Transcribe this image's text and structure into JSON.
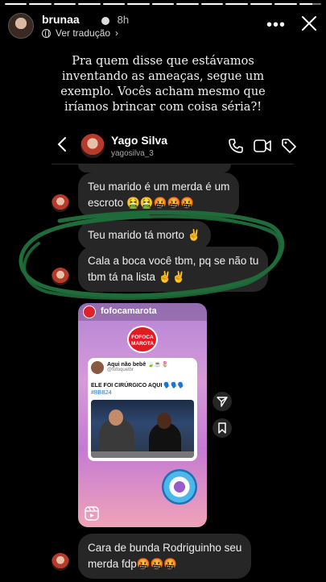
{
  "story": {
    "segments": [
      1,
      1,
      1,
      1,
      1,
      1,
      1,
      1,
      1,
      1,
      1,
      1,
      0.6
    ],
    "username": "brunaa",
    "time": "8h",
    "translate_label": "Ver tradução",
    "more_icon": "more-horizontal-icon",
    "close_icon": "close-icon"
  },
  "caption": {
    "lines": [
      "Pra quem disse que estávamos",
      "inventando as ameaças, segue um",
      "exemplo. Vocês acham mesmo que",
      "iríamos brincar com coisa séria?!"
    ]
  },
  "dm_header": {
    "name": "Yago Silva",
    "handle": "yagosilva_3",
    "icons": [
      "back-icon",
      "call-icon",
      "video-call-icon",
      "tag-icon"
    ]
  },
  "messages": [
    {
      "lines": [
        "Teu marido é um merda é um",
        "escroto 🤮🤮🤬🤬🤬"
      ]
    },
    {
      "lines": [
        "Teu marido tá morto ✌️"
      ]
    },
    {
      "lines": [
        "Cala a boca você tbm, pq se não tu",
        "tbm tá na lista ✌️✌️"
      ]
    },
    {
      "lines": [
        "Cara de bunda Rodriguinho seu",
        "merda fdp🤬🤬🤬"
      ]
    }
  ],
  "reel": {
    "username": "fofocamarota",
    "badge_lines": [
      "FOFOCA",
      "MAROTA"
    ],
    "tweet_name": "Aqui não bebê 🍃☕🌷",
    "tweet_handle": "@fofoquelbr",
    "tweet_text": "ELE FOI CIRÚRGICO AQUI 🗣️🗣️🗣️",
    "tweet_tag": "#BBB24"
  },
  "colors": {
    "background": "#000000",
    "bubble": "#262626",
    "scribble": "#1f6b3a",
    "reel_gradient_top": "#b484d6",
    "reel_gradient_bottom": "#f0a3b8"
  }
}
